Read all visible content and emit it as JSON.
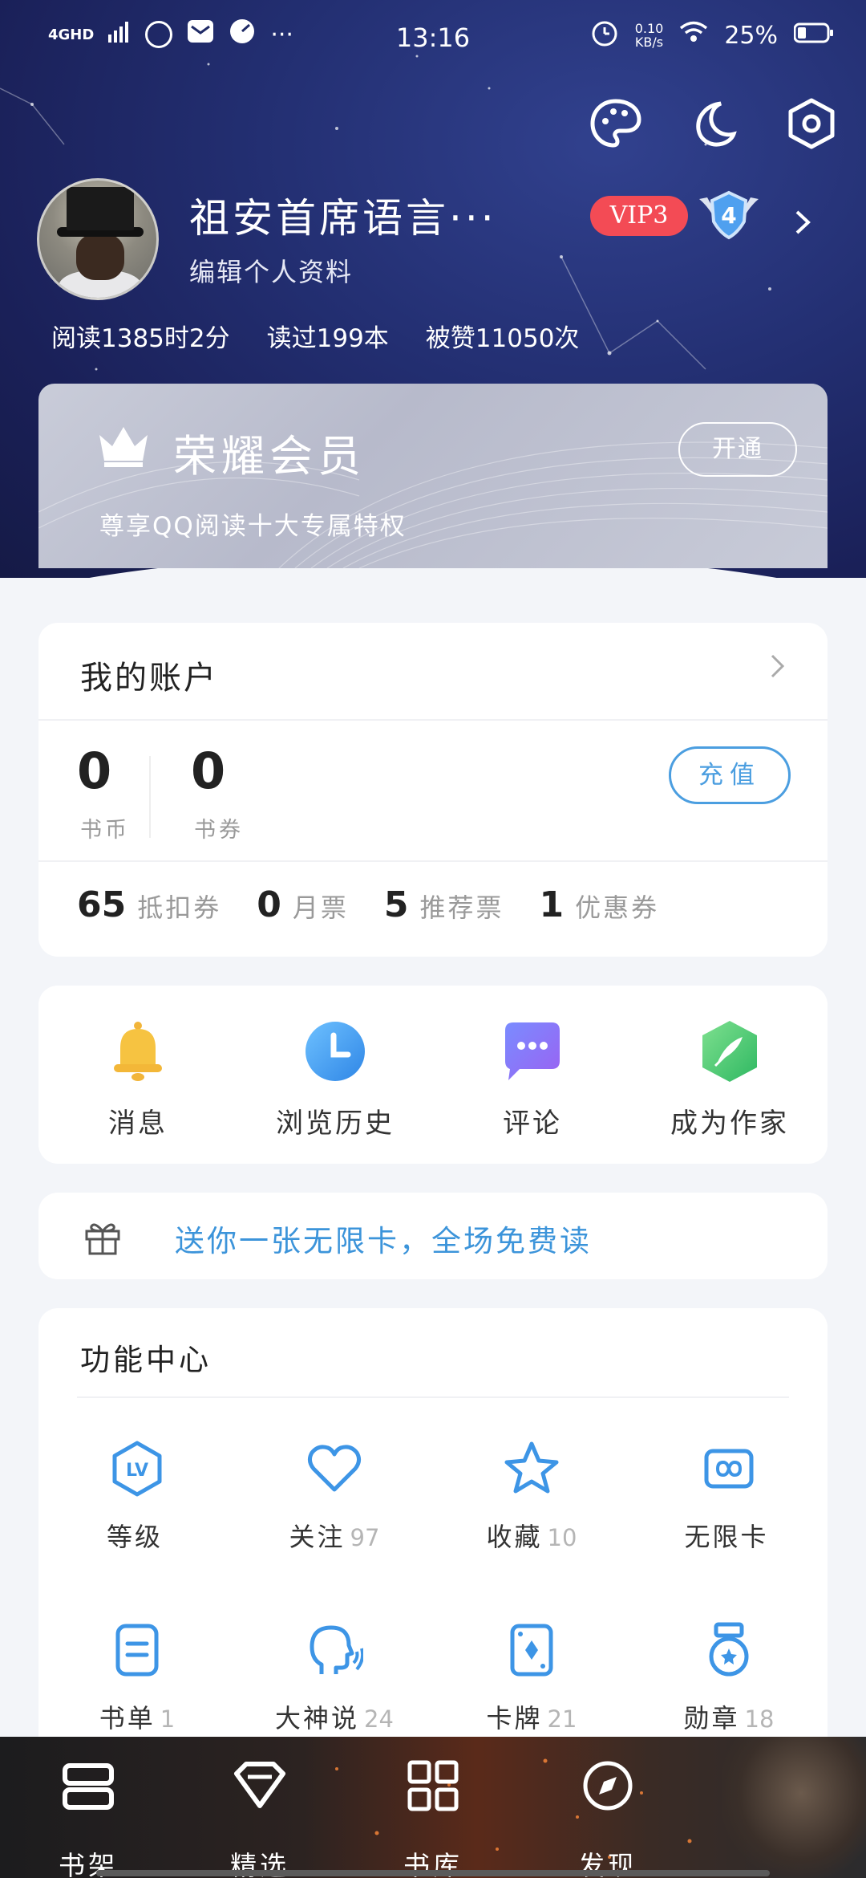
{
  "status_bar": {
    "network": "4GHD",
    "time": "13:16",
    "speed_value": "0.10",
    "speed_unit": "KB/s",
    "battery": "25%"
  },
  "profile": {
    "username": "祖安首席语言···",
    "edit_label": "编辑个人资料",
    "vip_label": "VIP3",
    "level_number": "4",
    "stats": [
      "阅读1385时2分",
      "读过199本",
      "被赞11050次"
    ]
  },
  "vip_card": {
    "title": "荣耀会员",
    "subtitle": "尊享QQ阅读十大专属特权",
    "button_label": "开通"
  },
  "account": {
    "title": "我的账户",
    "coins_value": "0",
    "coins_label": "书币",
    "vouchers_value": "0",
    "vouchers_label": "书券",
    "recharge_label": "充值",
    "tickets": [
      {
        "value": "65",
        "label": "抵扣券"
      },
      {
        "value": "0",
        "label": "月票"
      },
      {
        "value": "5",
        "label": "推荐票"
      },
      {
        "value": "1",
        "label": "优惠券"
      }
    ]
  },
  "quick_actions": [
    {
      "label": "消息",
      "icon": "bell-icon"
    },
    {
      "label": "浏览历史",
      "icon": "clock-icon"
    },
    {
      "label": "评论",
      "icon": "comment-icon"
    },
    {
      "label": "成为作家",
      "icon": "quill-icon"
    }
  ],
  "promo": {
    "text": "送你一张无限卡，全场免费读",
    "icon": "gift-icon"
  },
  "function_center": {
    "title": "功能中心",
    "items": [
      {
        "label": "等级",
        "count": "",
        "icon": "level-icon"
      },
      {
        "label": "关注",
        "count": "97",
        "icon": "heart-icon"
      },
      {
        "label": "收藏",
        "count": "10",
        "icon": "star-icon"
      },
      {
        "label": "无限卡",
        "count": "",
        "icon": "infinity-card-icon"
      },
      {
        "label": "书单",
        "count": "1",
        "icon": "booklist-icon"
      },
      {
        "label": "大神说",
        "count": "24",
        "icon": "speaking-head-icon"
      },
      {
        "label": "卡牌",
        "count": "21",
        "icon": "card-icon"
      },
      {
        "label": "勋章",
        "count": "18",
        "icon": "medal-icon"
      }
    ]
  },
  "bottom_nav": [
    {
      "label": "书架",
      "icon": "bookshelf-icon"
    },
    {
      "label": "精选",
      "icon": "diamond-icon"
    },
    {
      "label": "书库",
      "icon": "grid-icon"
    },
    {
      "label": "发现",
      "icon": "compass-icon"
    }
  ],
  "colors": {
    "hero_bg": "#1f2a66",
    "vip_red": "#f34b55",
    "accent_blue": "#3c94da",
    "page_bg": "#f3f5f9"
  }
}
